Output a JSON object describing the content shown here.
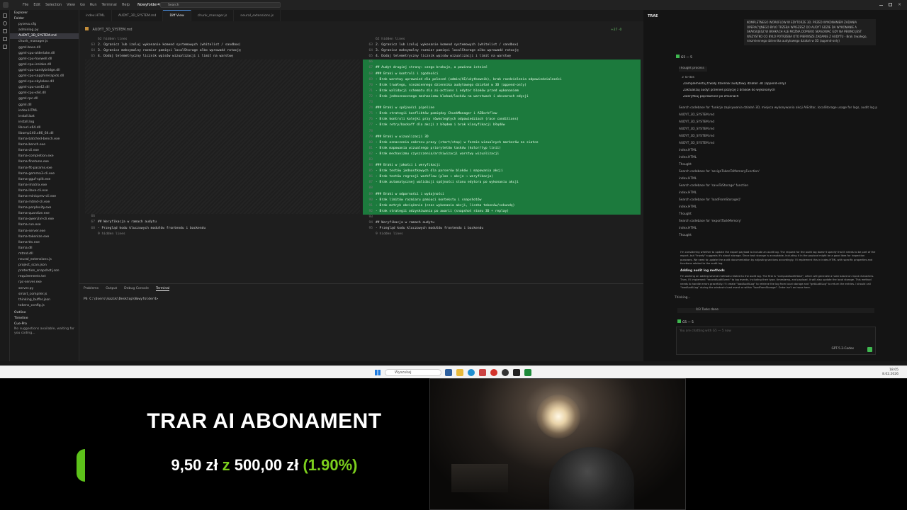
{
  "menubar": {
    "items": [
      "File",
      "Edit",
      "Selection",
      "View",
      "Go",
      "Run",
      "Terminal",
      "Help"
    ],
    "folder": "Nowyfolder4",
    "search_placeholder": "Search"
  },
  "sidebar": {
    "title": "Explorer",
    "section": "Folder",
    "items": [
      "pysevu.cfg",
      "adminlog.py",
      "AUDYT_3D_SYSTEM.md",
      "chunk_manager.js",
      "ggml-base.dll",
      "ggml-cpu-alderlake.dll",
      "ggml-cpu-haswell.dll",
      "ggml-cpu-icelake.dll",
      "ggml-cpu-sandybridge.dll",
      "ggml-cpu-sapphirerapids.dll",
      "ggml-cpu-skylakex.dll",
      "ggml-cpu-sse42.dll",
      "ggml-cpu-x64.dll",
      "ggml-rpc.dll",
      "ggml.dll",
      "index.HTML",
      "install.bat",
      "install.log",
      "libcurl-x64.dll",
      "libomp140.x86_64.dll",
      "llama-batched-bench.exe",
      "llama-bench.exe",
      "llama-cli.exe",
      "llama-completion.exe",
      "llama-finetune.exe",
      "llama-fit-params.exe",
      "llama-gemma3-cli.exe",
      "llama-gguf-split.exe",
      "llama-imatrix.exe",
      "llama-llava-cli.exe",
      "llama-minicpmv-cli.exe",
      "llama-mtmd-cli.exe",
      "llama-perplexity.exe",
      "llama-quantize.exe",
      "llama-qwen2vl-cli.exe",
      "llama-run.exe",
      "llama-server.exe",
      "llama-tokenize.exe",
      "llama-tts.exe",
      "llama.dll",
      "mtmd.dll",
      "neural_extensions.js",
      "project_scan.json",
      "protection_snapshot.json",
      "requirements.txt",
      "rpc-server.exe",
      "server.py",
      "smart_compiler.js",
      "thinking_buffer.json",
      "tokens_config.js"
    ],
    "outline": "Outline",
    "timeline": "Timeline",
    "cue": "Cue-Pro",
    "cue_note": "No suggestions available, waiting for you coding..."
  },
  "tabs": [
    {
      "label": "index.HTML",
      "active": false
    },
    {
      "label": "AUDYT_3D_SYSTEM.md",
      "active": false
    },
    {
      "label": "Diff View",
      "active": true
    },
    {
      "label": "chunk_manager.js",
      "active": false
    },
    {
      "label": "neural_extensions.js",
      "active": false
    }
  ],
  "breadcrumb": "AUDYT_3D_SYSTEM.md",
  "diff": {
    "hidden_top": "62 hidden lines",
    "hidden_bottom": "9 hidden lines",
    "left_lines": [
      {
        "n": "63",
        "t": "2. Ogranicz lub izoluj wykonanie komend systemowych (whitelist / sandbox)"
      },
      {
        "n": "64",
        "t": "3. Ogranicz maksymalny rozmiar pamięci localStorage albo wprowadź rotację"
      },
      {
        "n": "65",
        "t": "4. Dodaj telemetryczny licznik wpisów wizualizacji i limit na warstwę"
      }
    ],
    "left_tail": [
      {
        "n": "66",
        "t": ""
      },
      {
        "n": "67",
        "t": "## Weryfikacja w ramach audytu"
      },
      {
        "n": "68",
        "t": "- Przegląd kodu kluczowych modułów frontendu i backendu"
      }
    ],
    "right_lines": [
      {
        "n": "63",
        "t": "2. Ogranicz lub izoluj wykonanie komend systemowych (whitelist / sandbox)"
      },
      {
        "n": "64",
        "t": "3. Ogranicz maksymalny rozmiar pamięci localStorage albo wprowadź rotację"
      },
      {
        "n": "65",
        "t": "4. Dodaj telemetryczny licznik wpisów wizualizacji i limit na warstwę"
      }
    ],
    "added": [
      {
        "n": "66",
        "t": ""
      },
      {
        "n": "67",
        "t": "## Audyt drugiej strony: czego brakuje, a powinno istnieć"
      },
      {
        "n": "68",
        "t": "### Braki w kontroli i zgodności"
      },
      {
        "n": "69",
        "t": "- Brak warstwy uprawnień dla poleceń (admin/AI/użytkownik), brak rozdzielenia odpowiedzialności"
      },
      {
        "n": "70",
        "t": "- Brak trwałego, niezmiennego dziennika audytowego działań w 3D (append-only)"
      },
      {
        "n": "71",
        "t": "- Brak walidacji schematu dla ai-actions i edytor bloków przed wykonaniem"
      },
      {
        "n": "72",
        "t": "- Brak jednoznacznego mechanizmu blokad/locków na warstwach i obszarach edycji"
      },
      {
        "n": "73",
        "t": ""
      },
      {
        "n": "74",
        "t": "### Braki w spójności pipeline"
      },
      {
        "n": "75",
        "t": "- Brak strategii konfliktów pomiędzy ChunkManager i AIBorkflow"
      },
      {
        "n": "76",
        "t": "- Brak kontroli kolejki przy równoległych odpowiedziach (race conditions)"
      },
      {
        "n": "77",
        "t": "- Brak retry/backoff dla akcji z błędem i brak klasyfikacji błędów"
      },
      {
        "n": "78",
        "t": ""
      },
      {
        "n": "79",
        "t": "### Braki w wizualizacji 3D"
      },
      {
        "n": "80",
        "t": "- Brak oznaczenia zakresu pracy (start/stop) w formie wizualnych markerów na siatce"
      },
      {
        "n": "81",
        "t": "- Brak mapowania wizualnego priorytetów tasków (kolor/typ linii)"
      },
      {
        "n": "82",
        "t": "- Brak mechanizmu czyszczenia/archiwizacji warstwy wizualizacji"
      },
      {
        "n": "83",
        "t": ""
      },
      {
        "n": "84",
        "t": "### Braki w jakości i weryfikacji"
      },
      {
        "n": "85",
        "t": "- Brak testów jednostkowych dla parserów bloków i mapowania akcji"
      },
      {
        "n": "86",
        "t": "- Brak testów regresji workflow (plan → akcje → weryfikacja)"
      },
      {
        "n": "87",
        "t": "- Brak automatycznej walidacji spójności stanu edytora po wykonaniu akcji"
      },
      {
        "n": "88",
        "t": ""
      },
      {
        "n": "89",
        "t": "### Braki w odporności i wydajności"
      },
      {
        "n": "90",
        "t": "- Brak limitów rozmiaru pamięci kontekstu i snapshotów"
      },
      {
        "n": "91",
        "t": "- Brak metryk obciążenia (czas wykonania akcji, liczba tokenów/sekundę)"
      },
      {
        "n": "92",
        "t": "- Brak strategii odzyskiwania po awarii (snapshot stanu 3D + replay)"
      }
    ],
    "right_tail": [
      {
        "n": "93",
        "t": ""
      },
      {
        "n": "94",
        "t": "## Weryfikacja w ramach audytu"
      },
      {
        "n": "95",
        "t": "- Przegląd kodu kluczowych modułów frontendu i backendu"
      }
    ],
    "change_count": "+27 -0"
  },
  "panel": {
    "tabs": [
      "Problems",
      "Output",
      "Debug Console",
      "Terminal"
    ],
    "prompt": "PS C:\\Users\\kazik\\Desktop\\Nowyfolder4>"
  },
  "chat": {
    "title": "TRAE",
    "user_message": "KOMPLETNEGO WORKFLOW W EDYTORZE 3D. PRZED WYKONANIEM ZADANIA OPERACYJNEGO BYŁO TRZEBA WPISZESZ DO AUDYT GDZIE DA WYKONANIE A SKAKSUJESZ W BRAKACH ALE MOŻNA DOPIERO SKASOWAĆ GDY NA PEWNO JEST WSZYSTKO CO BYŁO POTRZEBA OTO PIERWSZE ZADANIE Z AUDYTU - Brak trwałego, niezmiennego dziennika audytowego działań w 3D (append-only)",
    "model_badge": "G5 — 5",
    "thought": "Thought process",
    "todo_header": "3 To-dos",
    "todos": [
      "Zaimplementuj trwały dziennik audytowy działań 3D (append-only)",
      "Zaktualizuj audyt przenieś pozycję z braków do wykonanych",
      "Zweryfikuj poprawność po zmianach"
    ],
    "steps": [
      "Search codebase for 'funkcje zapisywania działań 3D, miejsca wykonywania akcji AIEditor, localStorage usage for logs, audit log patterns'",
      "AUDYT_3D_SYSTEM.md",
      "AUDYT_3D_SYSTEM.md",
      "AUDYT_3D_SYSTEM.md",
      "AUDYT_3D_SYSTEM.md",
      "AUDYT_3D_SYSTEM.md",
      "index.HTML",
      "index.HTML",
      "Thought",
      "Search codebase for 'assignTokenToMemoryFunction'",
      "index.HTML",
      "Search codebase for 'saveToStorage' function",
      "index.HTML",
      "Search codebase for 'loadFromStorage()'",
      "index.HTML",
      "Thought",
      "Search codebase for 'exportTaskMemory'",
      "index.HTML",
      "Thought"
    ],
    "para1": "I'm considering whether to update the export payload to include an audit log. The request for the audit log doesn't specify that it needs to be part of the export, but \"trwały\" suggests it's about storage. Since task storage is acceptable, including it in the payload might be a good idea for inspection purposes. We need to update the audit documentation by adjusting sections accordingly. I'll implement this in index.HTML with specific properties and functions related to the audit log.",
    "section_title": "Adding audit log methods",
    "para2": "I'm working on adding several methods related to the audit log. The first is \"computeAuditHash\", which will generate a hash based on input characters. Then, I'll implement \"recordAuditEvent\" to log events, including their type, timestamp, and payload. It will also update the local storage. This method needs to handle errors gracefully. I'll create \"loadAuditLog\" to retrieve the log from local storage and \"getAuditLog\" to return the entries. I should call \"loadAuditLog\" during the window's load event or within \"loadFromStorage\". Order isn't an issue here.",
    "thinking": "Thinking...",
    "tasks_done": "0/3 Tasks done",
    "assistant_badge": "G5 — 5",
    "input_placeholder": "You are chatting with G5 — 5 now",
    "model_select": "GPT-5.2-Codex"
  },
  "taskbar": {
    "search_placeholder": "Wyszukaj",
    "time": "18:05",
    "date": "8.02.2026"
  },
  "overlay": {
    "title": "TRAR AI ABONAMENT",
    "amount": "9,50 zł",
    "of_word": "z",
    "total": "500,00 zł",
    "percent": "(1.90%)",
    "accent": "#7ccf1d",
    "progress_fraction": 0.019
  }
}
